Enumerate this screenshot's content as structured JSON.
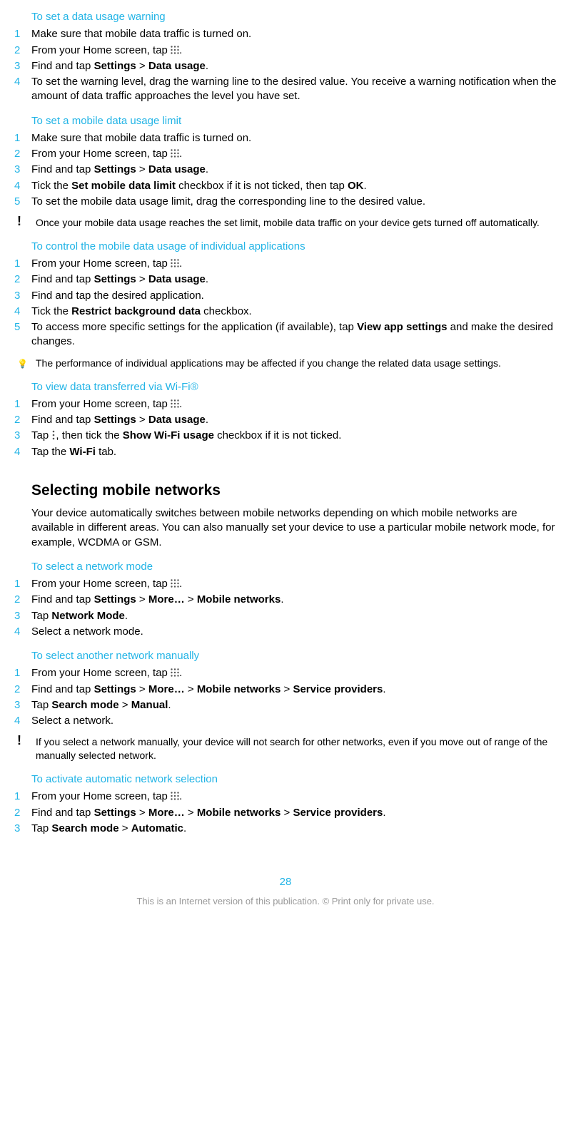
{
  "sections": {
    "warning": {
      "heading": "To set a data usage warning",
      "steps": [
        {
          "n": "1",
          "parts": [
            {
              "t": "Make sure that mobile data traffic is turned on."
            }
          ]
        },
        {
          "n": "2",
          "parts": [
            {
              "t": "From your Home screen, tap "
            },
            {
              "icon": "apps"
            },
            {
              "t": "."
            }
          ]
        },
        {
          "n": "3",
          "parts": [
            {
              "t": "Find and tap "
            },
            {
              "b": "Settings"
            },
            {
              "t": " > "
            },
            {
              "b": "Data usage"
            },
            {
              "t": "."
            }
          ]
        },
        {
          "n": "4",
          "parts": [
            {
              "t": "To set the warning level, drag the warning line to the desired value. You receive a warning notification when the amount of data traffic approaches the level you have set."
            }
          ]
        }
      ]
    },
    "limit": {
      "heading": "To set a mobile data usage limit",
      "steps": [
        {
          "n": "1",
          "parts": [
            {
              "t": "Make sure that mobile data traffic is turned on."
            }
          ]
        },
        {
          "n": "2",
          "parts": [
            {
              "t": "From your Home screen, tap "
            },
            {
              "icon": "apps"
            },
            {
              "t": "."
            }
          ]
        },
        {
          "n": "3",
          "parts": [
            {
              "t": "Find and tap "
            },
            {
              "b": "Settings"
            },
            {
              "t": " > "
            },
            {
              "b": "Data usage"
            },
            {
              "t": "."
            }
          ]
        },
        {
          "n": "4",
          "parts": [
            {
              "t": "Tick the "
            },
            {
              "b": "Set mobile data limit"
            },
            {
              "t": " checkbox if it is not ticked, then tap "
            },
            {
              "b": "OK"
            },
            {
              "t": "."
            }
          ]
        },
        {
          "n": "5",
          "parts": [
            {
              "t": "To set the mobile data usage limit, drag the corresponding line to the desired value."
            }
          ]
        }
      ],
      "note": {
        "type": "warn",
        "text": "Once your mobile data usage reaches the set limit, mobile data traffic on your device gets turned off automatically."
      }
    },
    "individual": {
      "heading": "To control the mobile data usage of individual applications",
      "steps": [
        {
          "n": "1",
          "parts": [
            {
              "t": "From your Home screen, tap "
            },
            {
              "icon": "apps"
            },
            {
              "t": "."
            }
          ]
        },
        {
          "n": "2",
          "parts": [
            {
              "t": "Find and tap "
            },
            {
              "b": "Settings"
            },
            {
              "t": " > "
            },
            {
              "b": "Data usage"
            },
            {
              "t": "."
            }
          ]
        },
        {
          "n": "3",
          "parts": [
            {
              "t": "Find and tap the desired application."
            }
          ]
        },
        {
          "n": "4",
          "parts": [
            {
              "t": "Tick the "
            },
            {
              "b": "Restrict background data"
            },
            {
              "t": " checkbox."
            }
          ]
        },
        {
          "n": "5",
          "parts": [
            {
              "t": "To access more specific settings for the application (if available), tap "
            },
            {
              "b": "View app settings"
            },
            {
              "t": " and make the desired changes."
            }
          ]
        }
      ],
      "note": {
        "type": "tip",
        "text": "The performance of individual applications may be affected if you change the related data usage settings."
      }
    },
    "wifi": {
      "heading": "To view data transferred via Wi-Fi®",
      "steps": [
        {
          "n": "1",
          "parts": [
            {
              "t": "From your Home screen, tap "
            },
            {
              "icon": "apps"
            },
            {
              "t": "."
            }
          ]
        },
        {
          "n": "2",
          "parts": [
            {
              "t": "Find and tap "
            },
            {
              "b": "Settings"
            },
            {
              "t": " > "
            },
            {
              "b": "Data usage"
            },
            {
              "t": "."
            }
          ]
        },
        {
          "n": "3",
          "parts": [
            {
              "t": "Tap "
            },
            {
              "icon": "menu"
            },
            {
              "t": ", then tick the "
            },
            {
              "b": "Show Wi-Fi usage"
            },
            {
              "t": " checkbox if it is not ticked."
            }
          ]
        },
        {
          "n": "4",
          "parts": [
            {
              "t": "Tap the "
            },
            {
              "b": "Wi-Fi"
            },
            {
              "t": " tab."
            }
          ]
        }
      ]
    },
    "networks": {
      "big_heading": "Selecting mobile networks",
      "intro": "Your device automatically switches between mobile networks depending on which mobile networks are available in different areas. You can also manually set your device to use a particular mobile network mode, for example, WCDMA or GSM."
    },
    "netmode": {
      "heading": "To select a network mode",
      "steps": [
        {
          "n": "1",
          "parts": [
            {
              "t": "From your Home screen, tap "
            },
            {
              "icon": "apps"
            },
            {
              "t": "."
            }
          ]
        },
        {
          "n": "2",
          "parts": [
            {
              "t": "Find and tap "
            },
            {
              "b": "Settings"
            },
            {
              "t": " > "
            },
            {
              "b": "More…"
            },
            {
              "t": " > "
            },
            {
              "b": "Mobile networks"
            },
            {
              "t": "."
            }
          ]
        },
        {
          "n": "3",
          "parts": [
            {
              "t": "Tap "
            },
            {
              "b": "Network Mode"
            },
            {
              "t": "."
            }
          ]
        },
        {
          "n": "4",
          "parts": [
            {
              "t": "Select a network mode."
            }
          ]
        }
      ]
    },
    "manual": {
      "heading": "To select another network manually",
      "steps": [
        {
          "n": "1",
          "parts": [
            {
              "t": "From your Home screen, tap "
            },
            {
              "icon": "apps"
            },
            {
              "t": "."
            }
          ]
        },
        {
          "n": "2",
          "parts": [
            {
              "t": "Find and tap "
            },
            {
              "b": "Settings"
            },
            {
              "t": " > "
            },
            {
              "b": "More…"
            },
            {
              "t": " > "
            },
            {
              "b": "Mobile networks"
            },
            {
              "t": " > "
            },
            {
              "b": "Service providers"
            },
            {
              "t": "."
            }
          ]
        },
        {
          "n": "3",
          "parts": [
            {
              "t": "Tap "
            },
            {
              "b": "Search mode"
            },
            {
              "t": " > "
            },
            {
              "b": "Manual"
            },
            {
              "t": "."
            }
          ]
        },
        {
          "n": "4",
          "parts": [
            {
              "t": "Select a network."
            }
          ]
        }
      ],
      "note": {
        "type": "warn",
        "text": "If you select a network manually, your device will not search for other networks, even if you move out of range of the manually selected network."
      }
    },
    "auto": {
      "heading": "To activate automatic network selection",
      "steps": [
        {
          "n": "1",
          "parts": [
            {
              "t": "From your Home screen, tap "
            },
            {
              "icon": "apps"
            },
            {
              "t": "."
            }
          ]
        },
        {
          "n": "2",
          "parts": [
            {
              "t": "Find and tap "
            },
            {
              "b": "Settings"
            },
            {
              "t": " > "
            },
            {
              "b": "More…"
            },
            {
              "t": " > "
            },
            {
              "b": "Mobile networks"
            },
            {
              "t": " > "
            },
            {
              "b": "Service providers"
            },
            {
              "t": "."
            }
          ]
        },
        {
          "n": "3",
          "parts": [
            {
              "t": "Tap "
            },
            {
              "b": "Search mode"
            },
            {
              "t": " > "
            },
            {
              "b": "Automatic"
            },
            {
              "t": "."
            }
          ]
        }
      ]
    }
  },
  "page_number": "28",
  "footer": "This is an Internet version of this publication. © Print only for private use."
}
